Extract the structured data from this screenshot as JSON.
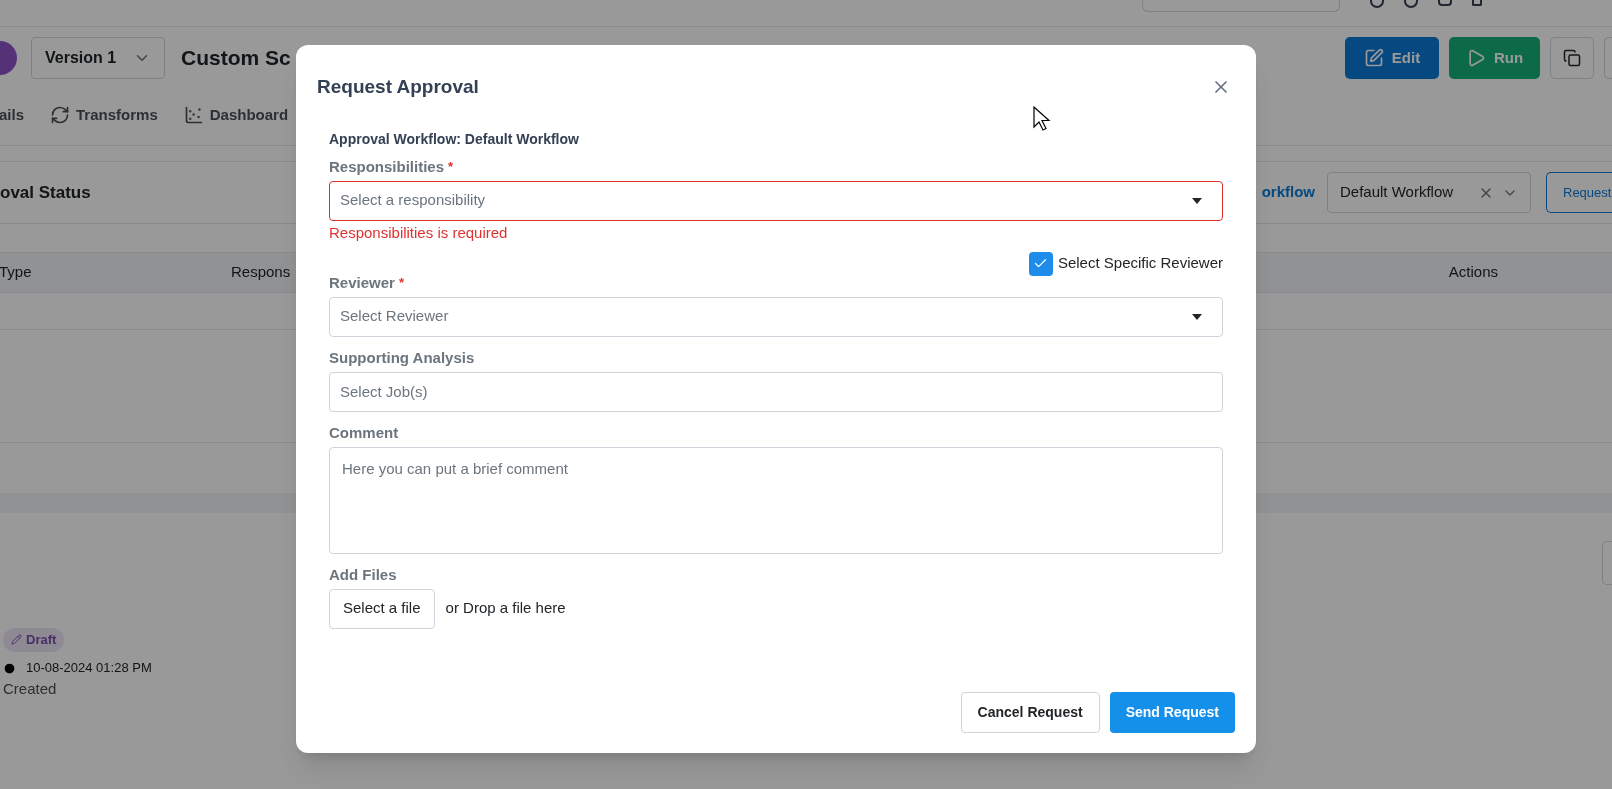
{
  "header": {
    "version_select": "Version 1",
    "title": "Custom Sc",
    "buttons": [
      {
        "kind": "edit",
        "label": "Edit"
      },
      {
        "kind": "run",
        "label": "Run"
      }
    ]
  },
  "tabs": [
    {
      "kind": "plain",
      "label": "ails"
    },
    {
      "kind": "transforms",
      "label": "Transforms"
    },
    {
      "kind": "dashboard",
      "label": "Dashboard"
    }
  ],
  "approval_status": {
    "title": "oval Status",
    "workflow_link": "orkflow",
    "workflow_select": "Default Workflow",
    "request_button": "Request"
  },
  "table": {
    "columns": [
      "Type",
      "Respons",
      "Actions"
    ]
  },
  "history": {
    "badge": "Draft",
    "timestamp": "10-08-2024 01:28 PM",
    "event": "Created"
  },
  "dialog": {
    "title": "Request Approval",
    "workflow_line": "Approval Workflow: Default Workflow",
    "fields": [
      {
        "kind": "select",
        "label": "Responsibilities",
        "required_mark": "*",
        "placeholder": "Select a responsibility",
        "error": "Responsibilities is required"
      },
      {
        "kind": "checkbox",
        "label": "Select Specific Reviewer",
        "checked": true
      },
      {
        "kind": "select",
        "label": "Reviewer",
        "required_mark": "*",
        "placeholder": "Select Reviewer"
      },
      {
        "kind": "input",
        "label": "Supporting Analysis",
        "placeholder": "Select Job(s)"
      },
      {
        "kind": "textarea",
        "label": "Comment",
        "placeholder": "Here you can put a brief comment"
      },
      {
        "kind": "file",
        "label": "Add Files",
        "button": "Select a file",
        "hint": "or Drop a file here"
      }
    ],
    "buttons": [
      {
        "kind": "secondary",
        "label": "Cancel Request"
      },
      {
        "kind": "primary",
        "label": "Send Request"
      }
    ]
  }
}
